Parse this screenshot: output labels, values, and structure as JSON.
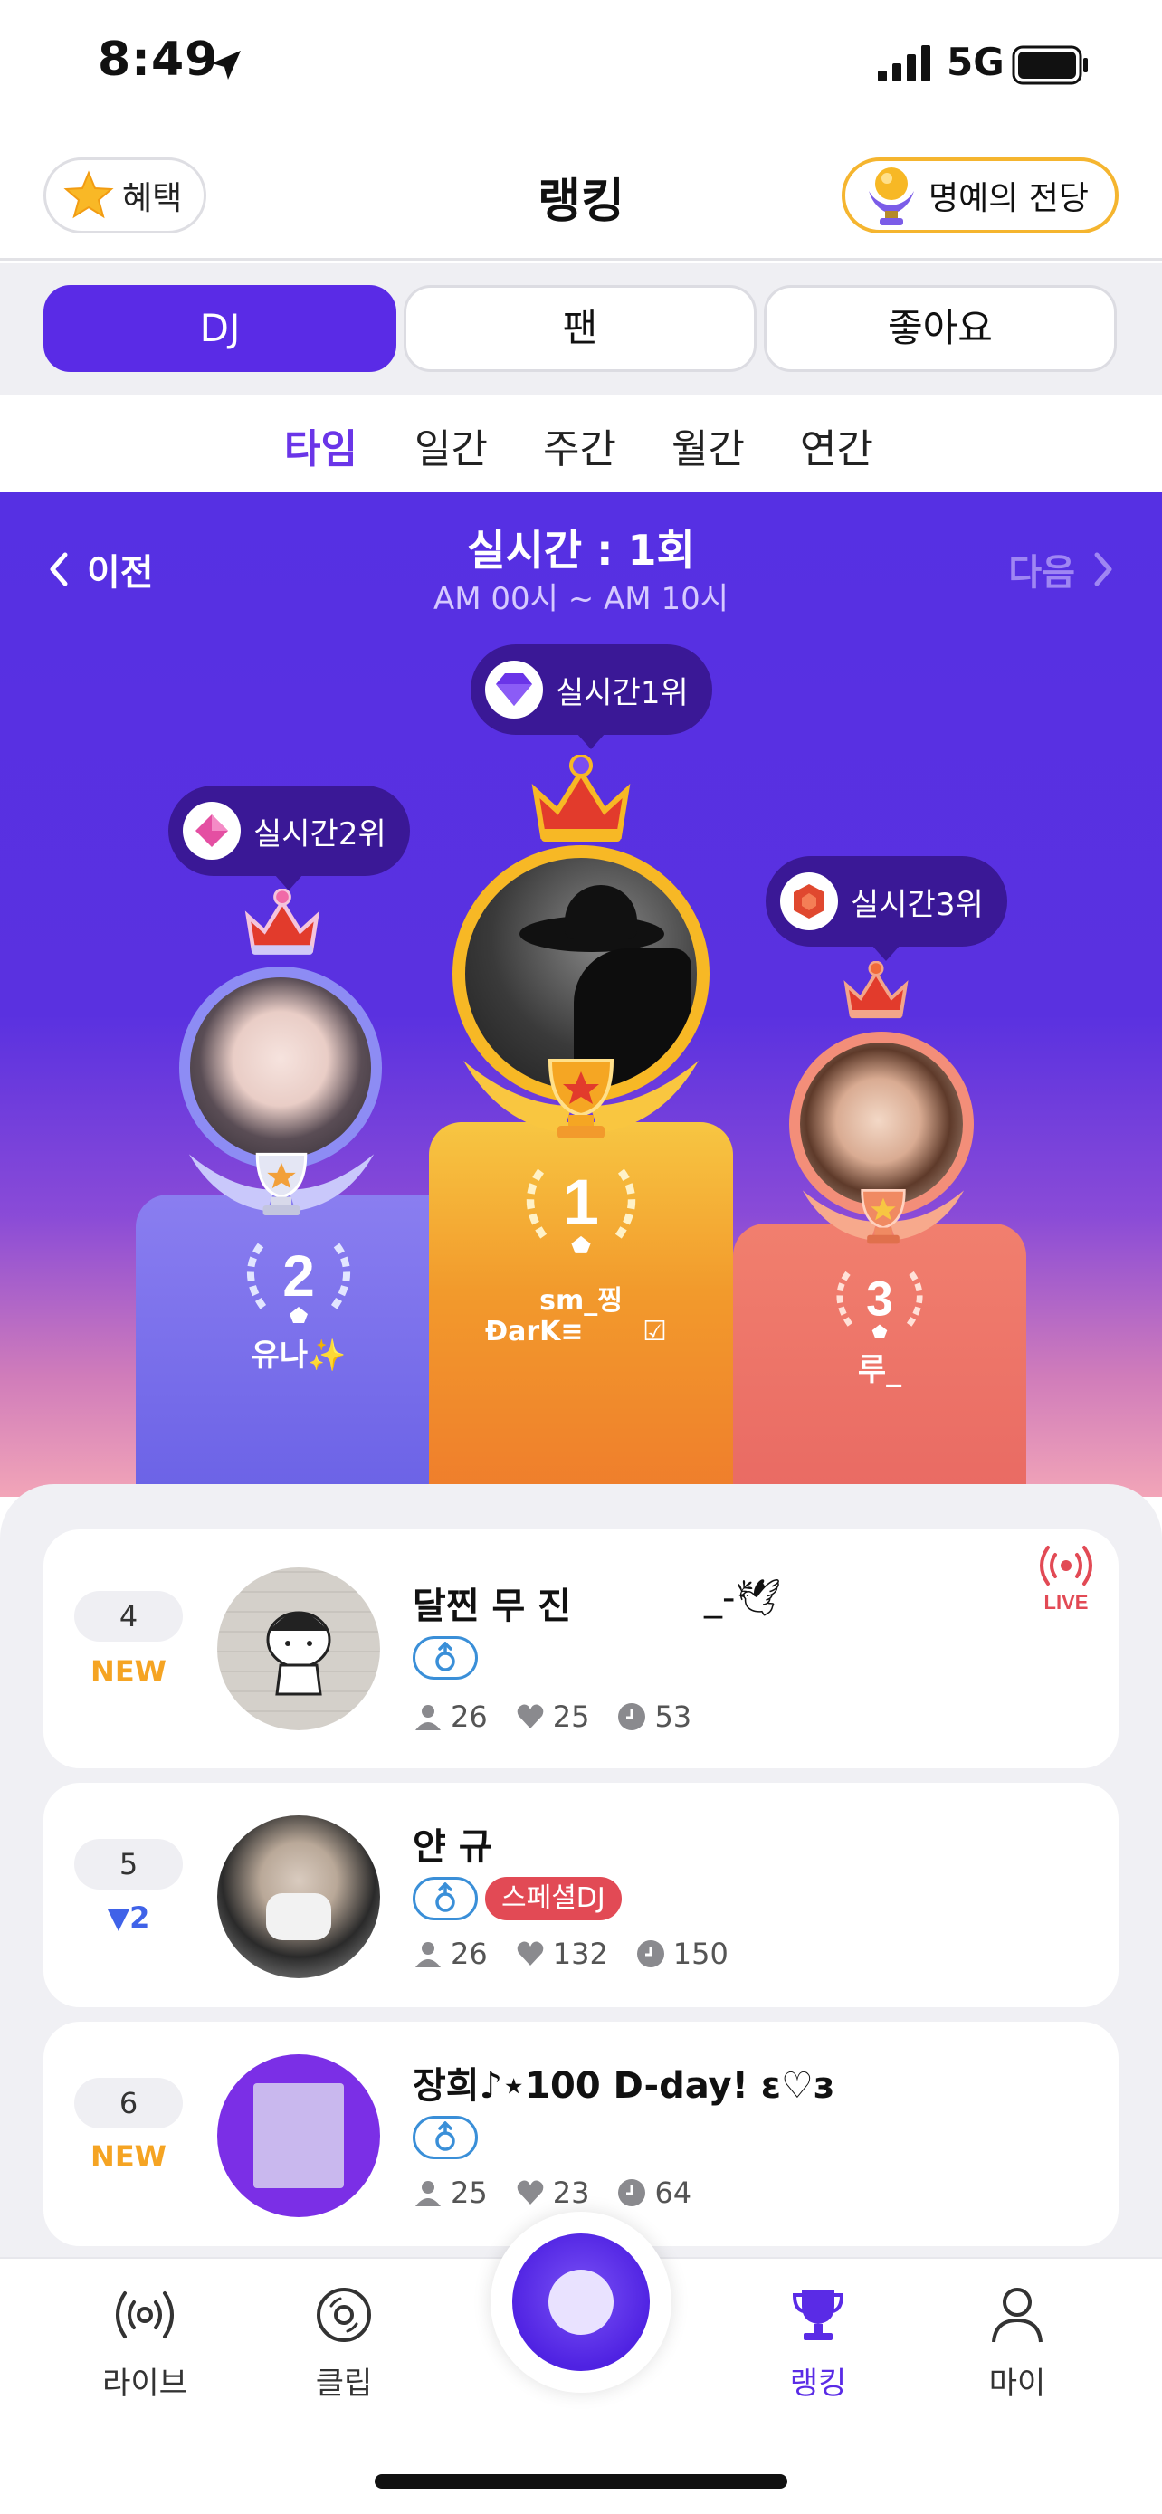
{
  "status_bar": {
    "time": "8:49",
    "network": "5G"
  },
  "header": {
    "benefit_label": "혜택",
    "title": "랭킹",
    "hall_label": "명예의 전당"
  },
  "segments": [
    {
      "label": "DJ",
      "active": true
    },
    {
      "label": "팬",
      "active": false
    },
    {
      "label": "좋아요",
      "active": false
    }
  ],
  "periods": [
    {
      "label": "타임",
      "active": true
    },
    {
      "label": "일간",
      "active": false
    },
    {
      "label": "주간",
      "active": false
    },
    {
      "label": "월간",
      "active": false
    },
    {
      "label": "연간",
      "active": false
    }
  ],
  "round": {
    "prev_label": "이전",
    "next_label": "다음",
    "title": "실시간 : 1회",
    "subtitle": "AM 00시 ~ AM 10시"
  },
  "podium": {
    "first": {
      "badge": "실시간1위",
      "rank": "1",
      "name_line1": "sm_찡",
      "name_line2": "ÐarK≡",
      "name_mark": "☑"
    },
    "second": {
      "badge": "실시간2위",
      "rank": "2",
      "name": "유나✨"
    },
    "third": {
      "badge": "실시간3위",
      "rank": "3",
      "name": "루_"
    }
  },
  "list": [
    {
      "rank": "4",
      "change": "NEW",
      "name": "달찐 무 진",
      "name_suffix": "_-🕊",
      "special": "",
      "listeners": "26",
      "likes": "25",
      "time": "53",
      "live_label": "LIVE"
    },
    {
      "rank": "5",
      "change": "▼2",
      "name": "얀 규",
      "name_suffix": "",
      "special": "스페셜DJ",
      "listeners": "26",
      "likes": "132",
      "time": "150",
      "live_label": ""
    },
    {
      "rank": "6",
      "change": "NEW",
      "name": "장희♪⋆100 D-day! ε♡з",
      "name_suffix": "",
      "special": "",
      "listeners": "25",
      "likes": "23",
      "time": "64",
      "live_label": ""
    }
  ],
  "tabbar": {
    "live": "라이브",
    "clip": "클립",
    "ranking": "랭킹",
    "my": "마이"
  },
  "colors": {
    "accent": "#5a2be6",
    "gold": "#f5b52f",
    "new": "#f5a423",
    "down": "#3f62e8",
    "live": "#e24a55"
  }
}
